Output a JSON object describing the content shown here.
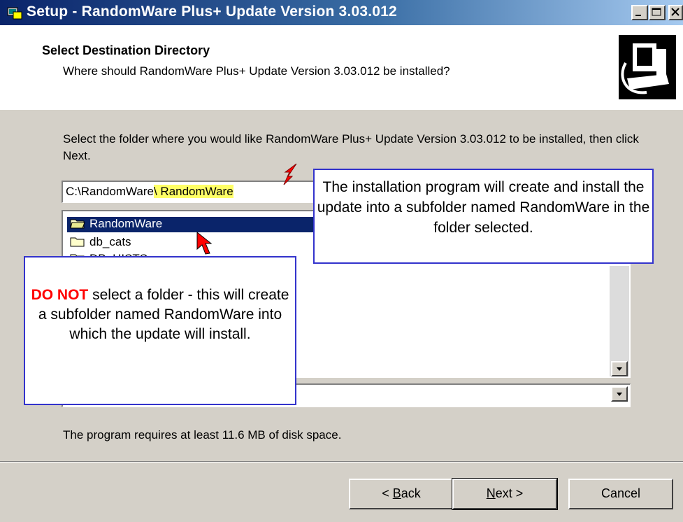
{
  "window": {
    "title": "Setup - RandomWare Plus+ Update Version 3.03.012",
    "controls": [
      "minimize",
      "maximize",
      "close"
    ]
  },
  "header": {
    "title": "Select Destination Directory",
    "subtitle": "Where should RandomWare Plus+ Update Version 3.03.012 be installed?",
    "logo_icon": "computer-install-icon"
  },
  "body": {
    "prompt": "Select the folder where you would like RandomWare Plus+ Update Version 3.03.012 to be installed, then click Next.",
    "path_value": "C:\\RandomWare",
    "path_suffix": "\\ RandomWare",
    "folders": [
      {
        "label": "RandomWare",
        "selected": true
      },
      {
        "label": "db_cats",
        "selected": false
      },
      {
        "label": "DB_HISTS",
        "selected": false
      }
    ],
    "disk_space": "The program requires at least 11.6 MB of disk space."
  },
  "callouts": {
    "right": "The installation program will create and install the update into a subfolder named RandomWare in the folder selected.",
    "left_emphasis": "DO NOT",
    "left_rest": "select a folder -  this will create a subfolder named RandomWare into which the update will install."
  },
  "buttons": {
    "back_prefix": "< ",
    "back_key": "B",
    "back_rest": "ack",
    "next_key": "N",
    "next_rest": "ext >",
    "cancel": "Cancel"
  },
  "colors": {
    "title_start": "#0a246a",
    "title_end": "#a6caf0",
    "callout_border": "#3333cc",
    "warning": "#ff0000",
    "highlight": "#ffff66",
    "selection": "#0a246a"
  }
}
